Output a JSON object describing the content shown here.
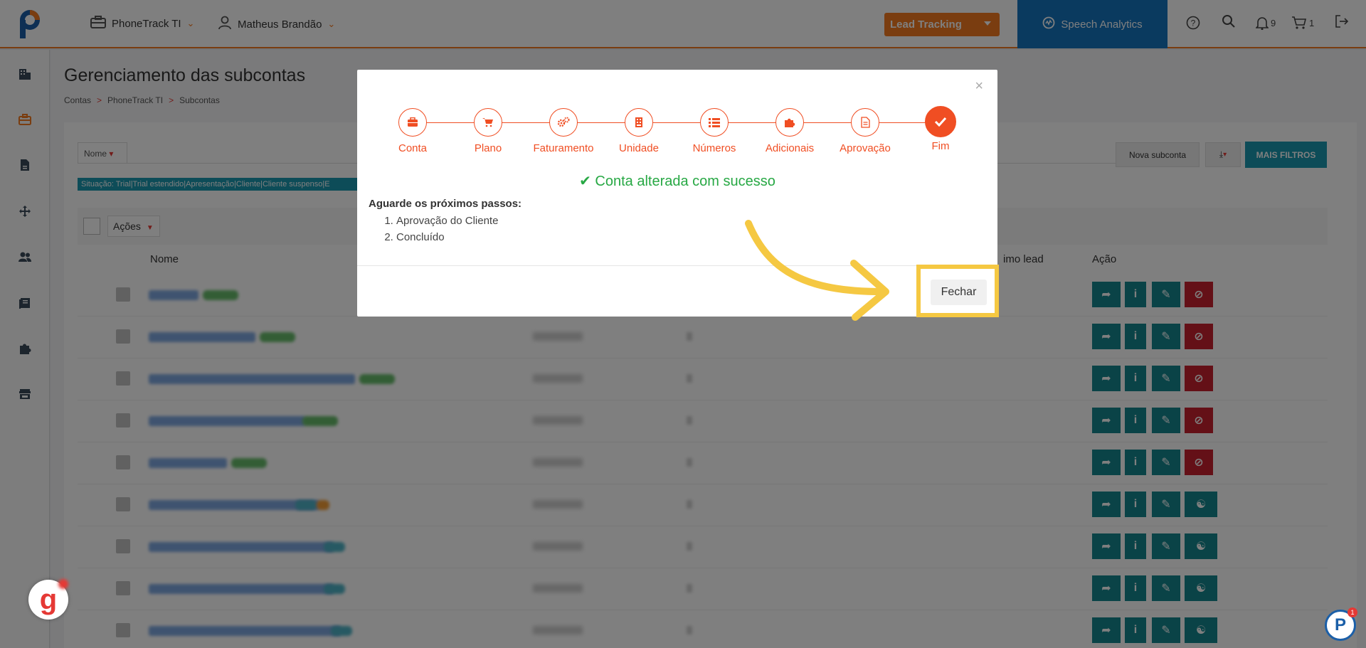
{
  "header": {
    "company": "PhoneTrack TI",
    "user": "Matheus Brandão",
    "product_select": "Lead Tracking",
    "speech_button": "Speech Analytics",
    "notifications_count": "9",
    "cart_count": "1"
  },
  "page": {
    "title": "Gerenciamento das subcontas",
    "breadcrumb": [
      "Contas",
      "PhoneTrack TI",
      "Subcontas"
    ],
    "breadcrumb_sep": ">"
  },
  "toolbar": {
    "filter_select": "Nome",
    "situation_chip": "Situação: Trial|Trial estendido|Apresentação|Cliente|Cliente suspenso|E",
    "new_subaccount": "Nova subconta",
    "more_filters": "MAIS FILTROS",
    "actions_select": "Ações"
  },
  "table": {
    "headers": {
      "name": "Nome",
      "last_lead": "imo lead",
      "action": "Ação"
    }
  },
  "modal": {
    "close": "×",
    "steps": [
      "Conta",
      "Plano",
      "Faturamento",
      "Unidade",
      "Números",
      "Adicionais",
      "Aprovação",
      "Fim"
    ],
    "success_message": "Conta alterada com sucesso",
    "next_title": "Aguarde os próximos passos:",
    "next_steps": [
      "Aprovação do Cliente",
      "Concluído"
    ],
    "close_button": "Fechar"
  },
  "colors": {
    "accent": "#f47b20",
    "step": "#f04e23",
    "speech_blue": "#1474bf",
    "teal": "#14878f",
    "danger": "#c8212e",
    "success": "#27a844",
    "highlight": "#f5c842"
  }
}
